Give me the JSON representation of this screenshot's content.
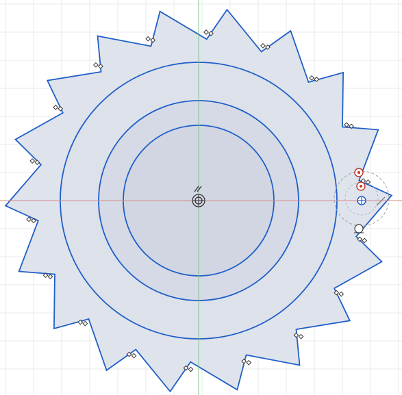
{
  "sketch": {
    "grid_color": "#e8eaee",
    "x_axis_color": "#d98a8a",
    "y_axis_color": "#7cc48a",
    "profile_fill": "#dfe3ec",
    "profile_stroke": "#1f5fc8",
    "circle_stroke": "#1f5fc8",
    "constraint_color": "#333333",
    "selected_point_color": "#c0392b",
    "tooth_count": 18,
    "circles": [
      {
        "name": "outer-circle"
      },
      {
        "name": "middle-circle"
      },
      {
        "name": "inner-circle"
      }
    ],
    "origin_marker": "origin",
    "parallel_marker_icon": "parallel-constraint-icon",
    "coincident_marker_icon": "coincident-constraint-icon",
    "construction_circle_icon": "construction-circle"
  }
}
